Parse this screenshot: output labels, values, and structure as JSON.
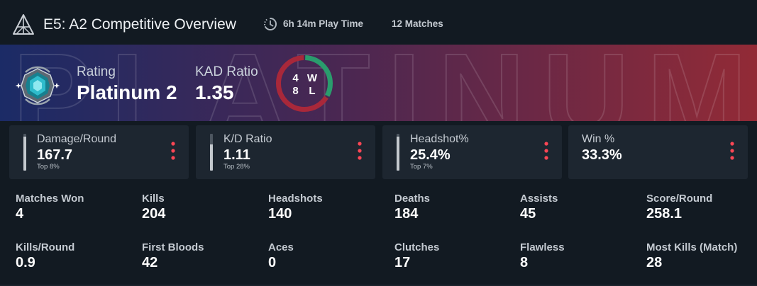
{
  "header": {
    "title": "E5: A2 Competitive Overview",
    "playtime": "6h 14m Play Time",
    "matches": "12 Matches",
    "icons": {
      "act": "act-pyramid-icon",
      "clock": "clock-icon"
    }
  },
  "banner": {
    "watermark": "PLATINUM",
    "rank_icon": "platinum-rank-icon",
    "rating_label": "Rating",
    "rating_value": "Platinum 2",
    "kad_label": "KAD Ratio",
    "kad_value": "1.35",
    "record": {
      "wins": 4,
      "wins_label": "W",
      "losses": 8,
      "losses_label": "L"
    }
  },
  "cards": [
    {
      "label": "Damage/Round",
      "value": "167.7",
      "rank": "Top 8%",
      "bar_level": 0.92
    },
    {
      "label": "K/D Ratio",
      "value": "1.11",
      "rank": "Top 28%",
      "bar_level": 0.72
    },
    {
      "label": "Headshot%",
      "value": "25.4%",
      "rank": "Top 7%",
      "bar_level": 0.93
    },
    {
      "label": "Win %",
      "value": "33.3%"
    }
  ],
  "card_menu_icon": "more-options-icon",
  "stats": [
    {
      "label": "Matches Won",
      "value": "4"
    },
    {
      "label": "Kills",
      "value": "204"
    },
    {
      "label": "Headshots",
      "value": "140"
    },
    {
      "label": "Deaths",
      "value": "184"
    },
    {
      "label": "Assists",
      "value": "45"
    },
    {
      "label": "Score/Round",
      "value": "258.1"
    },
    {
      "label": "Kills/Round",
      "value": "0.9"
    },
    {
      "label": "First Bloods",
      "value": "42"
    },
    {
      "label": "Aces",
      "value": "0"
    },
    {
      "label": "Clutches",
      "value": "17"
    },
    {
      "label": "Flawless",
      "value": "8"
    },
    {
      "label": "Most Kills (Match)",
      "value": "28"
    }
  ],
  "colors": {
    "accent": "#ff4655",
    "win": "#2a9c6d",
    "loss": "#a8283a",
    "banner_left": "#1b2b66",
    "banner_mid": "#4a2752",
    "banner_right": "#922a36"
  }
}
